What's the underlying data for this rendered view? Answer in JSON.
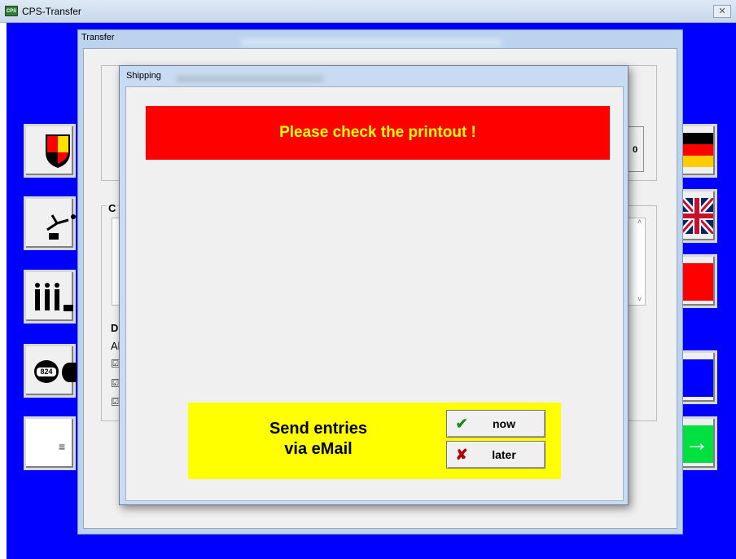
{
  "app": {
    "title": "CPS-Transfer",
    "icon_text": "CPS",
    "close_glyph": "✕"
  },
  "transfer": {
    "title": "Transfer",
    "left_fragments": [
      "C",
      "D",
      "Al"
    ],
    "checkbox_mark": "☑",
    "scroll_up": "˄",
    "scroll_down": "˅",
    "button_glyph": "0"
  },
  "side_buttons": {
    "badge_text": "824",
    "list_glyph": "≡",
    "arrow_glyph": "→"
  },
  "shipping": {
    "title": "Shipping",
    "alert": "Please check the printout !",
    "email_line1": "Send entries",
    "email_line2": "via eMail",
    "now_label": "now",
    "later_label": "later",
    "now_icon": "✔",
    "later_icon": "✘"
  },
  "colors": {
    "background_blue": "#0000ff",
    "alert_red": "#ff0000",
    "alert_text": "#ffff00",
    "panel_yellow": "#ffff00",
    "green_button": "#00e040"
  }
}
